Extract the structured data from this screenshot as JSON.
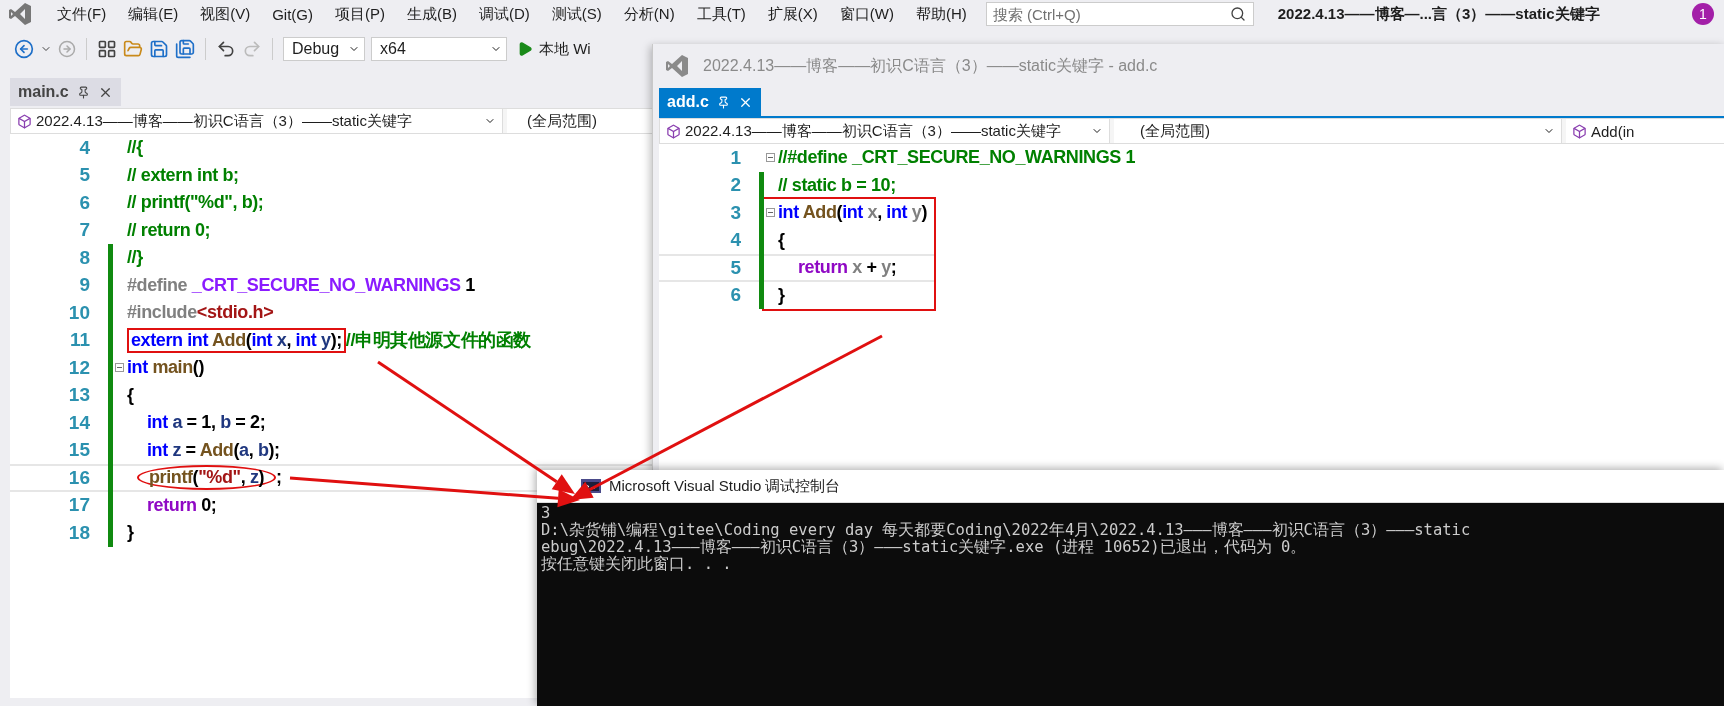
{
  "main_window": {
    "menu": [
      "文件(F)",
      "编辑(E)",
      "视图(V)",
      "Git(G)",
      "项目(P)",
      "生成(B)",
      "调试(D)",
      "测试(S)",
      "分析(N)",
      "工具(T)",
      "扩展(X)",
      "窗口(W)",
      "帮助(H)"
    ],
    "search": {
      "placeholder": "搜索 (Ctrl+Q)"
    },
    "title": "2022.4.13——博客—...言（3）——static关键字",
    "notification_count": "1",
    "toolbar": {
      "configuration": "Debug",
      "platform": "x64",
      "run_label": "本地 Wi"
    },
    "editor": {
      "tab": {
        "label": "main.c",
        "selected": false
      },
      "project": "2022.4.13——博客——初识C语言（3）——static关键字",
      "scope": "(全局范围)",
      "lines": [
        {
          "number": "4",
          "changed": false,
          "current": false,
          "foldable": false,
          "indented": false,
          "tokens": [
            {
              "kind": "comment",
              "text": "//{"
            }
          ]
        },
        {
          "number": "5",
          "changed": false,
          "current": false,
          "foldable": false,
          "indented": false,
          "tokens": [
            {
              "kind": "comment",
              "text": "// extern int b;"
            }
          ]
        },
        {
          "number": "6",
          "changed": false,
          "current": false,
          "foldable": false,
          "indented": false,
          "tokens": [
            {
              "kind": "comment",
              "text": "// printf(\"%d\", b);"
            }
          ]
        },
        {
          "number": "7",
          "changed": false,
          "current": false,
          "foldable": false,
          "indented": false,
          "tokens": [
            {
              "kind": "comment",
              "text": "// return 0;"
            }
          ]
        },
        {
          "number": "8",
          "changed": true,
          "current": false,
          "foldable": false,
          "indented": false,
          "tokens": [
            {
              "kind": "comment",
              "text": "//}"
            }
          ]
        },
        {
          "number": "9",
          "changed": true,
          "current": false,
          "foldable": false,
          "indented": false,
          "tokens": [
            {
              "kind": "preproc",
              "text": "#define "
            },
            {
              "kind": "macro",
              "text": "_CRT_SECURE_NO_WARNINGS"
            },
            {
              "kind": "plain",
              "text": " 1"
            }
          ]
        },
        {
          "number": "10",
          "changed": true,
          "current": false,
          "foldable": false,
          "indented": false,
          "tokens": [
            {
              "kind": "preproc",
              "text": "#include"
            },
            {
              "kind": "string",
              "text": "<stdio.h>"
            }
          ]
        },
        {
          "number": "11",
          "changed": true,
          "current": false,
          "foldable": false,
          "indented": false,
          "segments": [
            {
              "kind": "box",
              "tokens": [
                {
                  "kind": "keyword",
                  "text": "extern"
                },
                {
                  "kind": "keyword",
                  "text": " int"
                },
                {
                  "kind": "function",
                  "text": " Add"
                },
                {
                  "kind": "plain",
                  "text": "("
                },
                {
                  "kind": "keyword",
                  "text": "int"
                },
                {
                  "kind": "variable",
                  "text": " x"
                },
                {
                  "kind": "plain",
                  "text": ", "
                },
                {
                  "kind": "keyword",
                  "text": "int"
                },
                {
                  "kind": "variable",
                  "text": " y"
                },
                {
                  "kind": "plain",
                  "text": ");"
                }
              ]
            },
            {
              "kind": "plain",
              "tokens": [
                {
                  "kind": "comment",
                  "text": "//申明其他源文件的函数"
                }
              ]
            }
          ]
        },
        {
          "number": "12",
          "changed": true,
          "current": false,
          "foldable": true,
          "indented": false,
          "tokens": [
            {
              "kind": "keyword",
              "text": "int"
            },
            {
              "kind": "function",
              "text": " main"
            },
            {
              "kind": "plain",
              "text": "()"
            }
          ]
        },
        {
          "number": "13",
          "changed": true,
          "current": false,
          "foldable": false,
          "indented": false,
          "tokens": [
            {
              "kind": "plain",
              "text": "{"
            }
          ]
        },
        {
          "number": "14",
          "changed": true,
          "current": false,
          "foldable": false,
          "indented": true,
          "tokens": [
            {
              "kind": "keyword",
              "text": "int"
            },
            {
              "kind": "variable",
              "text": " a"
            },
            {
              "kind": "plain",
              "text": " = 1, "
            },
            {
              "kind": "variable",
              "text": "b"
            },
            {
              "kind": "plain",
              "text": " = 2;"
            }
          ]
        },
        {
          "number": "15",
          "changed": true,
          "current": false,
          "foldable": false,
          "indented": true,
          "tokens": [
            {
              "kind": "keyword",
              "text": "int"
            },
            {
              "kind": "variable",
              "text": " z"
            },
            {
              "kind": "plain",
              "text": " = "
            },
            {
              "kind": "function",
              "text": "Add"
            },
            {
              "kind": "plain",
              "text": "("
            },
            {
              "kind": "variable",
              "text": "a"
            },
            {
              "kind": "plain",
              "text": ", "
            },
            {
              "kind": "variable",
              "text": "b"
            },
            {
              "kind": "plain",
              "text": ");"
            }
          ]
        },
        {
          "number": "16",
          "changed": true,
          "current": true,
          "foldable": false,
          "indented": true,
          "segments": [
            {
              "kind": "ellipse",
              "tokens": [
                {
                  "kind": "function",
                  "text": "printf"
                },
                {
                  "kind": "plain",
                  "text": "("
                },
                {
                  "kind": "string",
                  "text": "\"%d\""
                },
                {
                  "kind": "plain",
                  "text": ", "
                },
                {
                  "kind": "variable",
                  "text": "z"
                },
                {
                  "kind": "plain",
                  "text": ")"
                }
              ]
            },
            {
              "kind": "plain",
              "tokens": [
                {
                  "kind": "plain",
                  "text": ";"
                }
              ]
            }
          ]
        },
        {
          "number": "17",
          "changed": true,
          "current": false,
          "foldable": false,
          "indented": true,
          "tokens": [
            {
              "kind": "control",
              "text": "return"
            },
            {
              "kind": "plain",
              "text": " 0;"
            }
          ]
        },
        {
          "number": "18",
          "changed": true,
          "current": false,
          "foldable": false,
          "indented": false,
          "tokens": [
            {
              "kind": "plain",
              "text": "}"
            }
          ]
        }
      ]
    }
  },
  "second_window": {
    "title": "2022.4.13——博客——初识C语言（3）——static关键字 - add.c",
    "editor": {
      "tab": {
        "label": "add.c",
        "selected": true
      },
      "project": "2022.4.13——博客——初识C语言（3）——static关键字",
      "scope": "(全局范围)",
      "member": "Add(in",
      "lines": [
        {
          "number": "1",
          "changed": false,
          "current": false,
          "foldable": true,
          "indented": false,
          "boxed": false,
          "tokens": [
            {
              "kind": "comment",
              "text": "//#define _CRT_SECURE_NO_WARNINGS 1"
            }
          ]
        },
        {
          "number": "2",
          "changed": true,
          "current": false,
          "foldable": false,
          "indented": false,
          "boxed": false,
          "tokens": [
            {
              "kind": "comment",
              "text": "// static b = 10;"
            }
          ]
        },
        {
          "number": "3",
          "changed": true,
          "current": false,
          "foldable": true,
          "indented": false,
          "boxed": true,
          "tokens": [
            {
              "kind": "keyword",
              "text": "int"
            },
            {
              "kind": "function",
              "text": " Add"
            },
            {
              "kind": "plain",
              "text": "("
            },
            {
              "kind": "keyword",
              "text": "int"
            },
            {
              "kind": "param",
              "text": " x"
            },
            {
              "kind": "plain",
              "text": ", "
            },
            {
              "kind": "keyword",
              "text": "int"
            },
            {
              "kind": "param",
              "text": " y"
            },
            {
              "kind": "plain",
              "text": ")"
            }
          ]
        },
        {
          "number": "4",
          "changed": true,
          "current": false,
          "foldable": false,
          "indented": false,
          "boxed": true,
          "tokens": [
            {
              "kind": "plain",
              "text": "{"
            }
          ]
        },
        {
          "number": "5",
          "changed": true,
          "current": true,
          "foldable": false,
          "indented": true,
          "boxed": true,
          "tokens": [
            {
              "kind": "control",
              "text": "return"
            },
            {
              "kind": "param",
              "text": " x"
            },
            {
              "kind": "plain",
              "text": " + "
            },
            {
              "kind": "param",
              "text": "y"
            },
            {
              "kind": "plain",
              "text": ";"
            }
          ]
        },
        {
          "number": "6",
          "changed": true,
          "current": false,
          "foldable": false,
          "indented": false,
          "boxed": true,
          "tokens": [
            {
              "kind": "plain",
              "text": "}"
            }
          ]
        }
      ]
    }
  },
  "console": {
    "title": "Microsoft Visual Studio 调试控制台",
    "lines": [
      "3",
      "D:\\杂货铺\\编程\\gitee\\Coding every day 每天都要Coding\\2022年4月\\2022.4.13———博客———初识C语言（3）———static",
      "ebug\\2022.4.13———博客———初识C语言（3）———static关键字.exe (进程 10652)已退出，代码为 0。",
      "按任意键关闭此窗口. . ."
    ]
  }
}
